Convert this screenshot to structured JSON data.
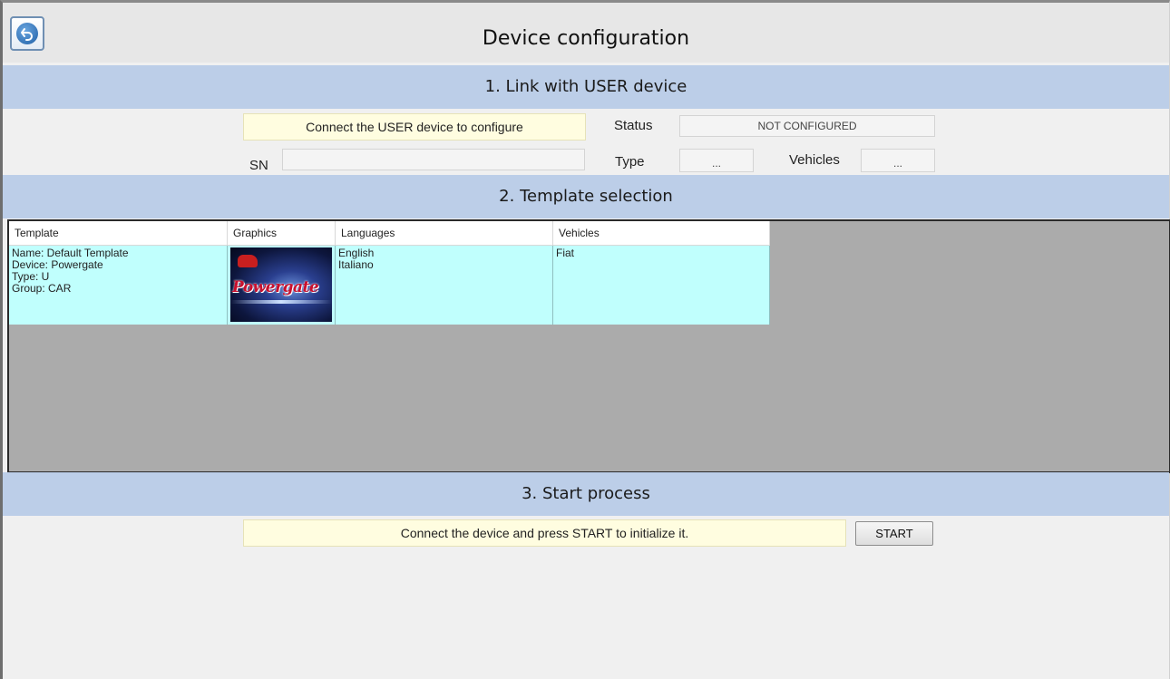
{
  "window": {
    "title": "Device configuration",
    "back_icon": "back-arrow-icon"
  },
  "section1": {
    "header": "1. Link with USER device",
    "notice": "Connect the USER device to configure",
    "status_label": "Status",
    "status_value": "NOT CONFIGURED",
    "sn_label": "SN",
    "sn_value": "",
    "type_label": "Type",
    "type_value": "...",
    "vehicles_label": "Vehicles",
    "vehicles_value": "..."
  },
  "section2": {
    "header": "2. Template selection",
    "columns": [
      "Template",
      "Graphics",
      "Languages",
      "Vehicles"
    ],
    "rows": [
      {
        "template": [
          "Name: Default Template",
          "Device: Powergate",
          "Type: U",
          "Group: CAR"
        ],
        "graphic_text": "Powergate",
        "languages": [
          "English",
          "Italiano"
        ],
        "vehicles": [
          "Fiat"
        ]
      }
    ]
  },
  "section3": {
    "header": "3. Start process",
    "notice": "Connect the device and press START to initialize it.",
    "start_label": "START"
  },
  "colors": {
    "section_header_bg": "#bccee8",
    "notice_bg": "#fffde0",
    "row_selected_bg": "#c0fffd",
    "grid_empty_bg": "#ababab"
  }
}
